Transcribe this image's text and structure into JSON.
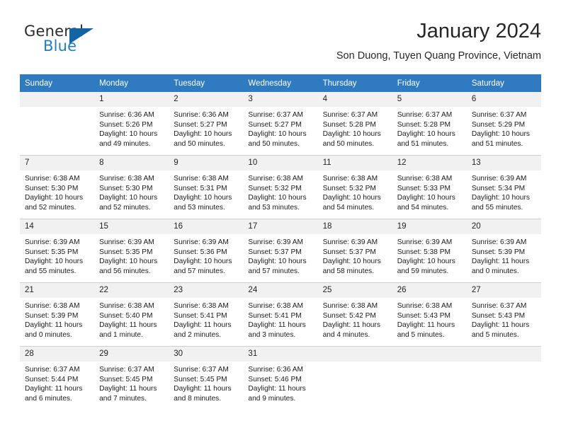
{
  "brand": {
    "name_part1": "General",
    "name_part2": "Blue",
    "triangle_color": "#1264a5",
    "blue_color": "#1f7ec4"
  },
  "header": {
    "title": "January 2024",
    "subtitle": "Son Duong, Tuyen Quang Province, Vietnam"
  },
  "theme": {
    "header_bg": "#2f7ac0",
    "daynum_bg": "#f1f1f1",
    "grid_line": "#cfcfcf"
  },
  "weekdays": [
    "Sunday",
    "Monday",
    "Tuesday",
    "Wednesday",
    "Thursday",
    "Friday",
    "Saturday"
  ],
  "weeks": [
    [
      {
        "day": "",
        "sunrise": "",
        "sunset": "",
        "daylight_line1": "",
        "daylight_line2": "",
        "blank": true
      },
      {
        "day": "1",
        "sunrise": "Sunrise: 6:36 AM",
        "sunset": "Sunset: 5:26 PM",
        "daylight_line1": "Daylight: 10 hours",
        "daylight_line2": "and 49 minutes."
      },
      {
        "day": "2",
        "sunrise": "Sunrise: 6:36 AM",
        "sunset": "Sunset: 5:27 PM",
        "daylight_line1": "Daylight: 10 hours",
        "daylight_line2": "and 50 minutes."
      },
      {
        "day": "3",
        "sunrise": "Sunrise: 6:37 AM",
        "sunset": "Sunset: 5:27 PM",
        "daylight_line1": "Daylight: 10 hours",
        "daylight_line2": "and 50 minutes."
      },
      {
        "day": "4",
        "sunrise": "Sunrise: 6:37 AM",
        "sunset": "Sunset: 5:28 PM",
        "daylight_line1": "Daylight: 10 hours",
        "daylight_line2": "and 50 minutes."
      },
      {
        "day": "5",
        "sunrise": "Sunrise: 6:37 AM",
        "sunset": "Sunset: 5:28 PM",
        "daylight_line1": "Daylight: 10 hours",
        "daylight_line2": "and 51 minutes."
      },
      {
        "day": "6",
        "sunrise": "Sunrise: 6:37 AM",
        "sunset": "Sunset: 5:29 PM",
        "daylight_line1": "Daylight: 10 hours",
        "daylight_line2": "and 51 minutes."
      }
    ],
    [
      {
        "day": "7",
        "sunrise": "Sunrise: 6:38 AM",
        "sunset": "Sunset: 5:30 PM",
        "daylight_line1": "Daylight: 10 hours",
        "daylight_line2": "and 52 minutes."
      },
      {
        "day": "8",
        "sunrise": "Sunrise: 6:38 AM",
        "sunset": "Sunset: 5:30 PM",
        "daylight_line1": "Daylight: 10 hours",
        "daylight_line2": "and 52 minutes."
      },
      {
        "day": "9",
        "sunrise": "Sunrise: 6:38 AM",
        "sunset": "Sunset: 5:31 PM",
        "daylight_line1": "Daylight: 10 hours",
        "daylight_line2": "and 53 minutes."
      },
      {
        "day": "10",
        "sunrise": "Sunrise: 6:38 AM",
        "sunset": "Sunset: 5:32 PM",
        "daylight_line1": "Daylight: 10 hours",
        "daylight_line2": "and 53 minutes."
      },
      {
        "day": "11",
        "sunrise": "Sunrise: 6:38 AM",
        "sunset": "Sunset: 5:32 PM",
        "daylight_line1": "Daylight: 10 hours",
        "daylight_line2": "and 54 minutes."
      },
      {
        "day": "12",
        "sunrise": "Sunrise: 6:38 AM",
        "sunset": "Sunset: 5:33 PM",
        "daylight_line1": "Daylight: 10 hours",
        "daylight_line2": "and 54 minutes."
      },
      {
        "day": "13",
        "sunrise": "Sunrise: 6:39 AM",
        "sunset": "Sunset: 5:34 PM",
        "daylight_line1": "Daylight: 10 hours",
        "daylight_line2": "and 55 minutes."
      }
    ],
    [
      {
        "day": "14",
        "sunrise": "Sunrise: 6:39 AM",
        "sunset": "Sunset: 5:35 PM",
        "daylight_line1": "Daylight: 10 hours",
        "daylight_line2": "and 55 minutes."
      },
      {
        "day": "15",
        "sunrise": "Sunrise: 6:39 AM",
        "sunset": "Sunset: 5:35 PM",
        "daylight_line1": "Daylight: 10 hours",
        "daylight_line2": "and 56 minutes."
      },
      {
        "day": "16",
        "sunrise": "Sunrise: 6:39 AM",
        "sunset": "Sunset: 5:36 PM",
        "daylight_line1": "Daylight: 10 hours",
        "daylight_line2": "and 57 minutes."
      },
      {
        "day": "17",
        "sunrise": "Sunrise: 6:39 AM",
        "sunset": "Sunset: 5:37 PM",
        "daylight_line1": "Daylight: 10 hours",
        "daylight_line2": "and 57 minutes."
      },
      {
        "day": "18",
        "sunrise": "Sunrise: 6:39 AM",
        "sunset": "Sunset: 5:37 PM",
        "daylight_line1": "Daylight: 10 hours",
        "daylight_line2": "and 58 minutes."
      },
      {
        "day": "19",
        "sunrise": "Sunrise: 6:39 AM",
        "sunset": "Sunset: 5:38 PM",
        "daylight_line1": "Daylight: 10 hours",
        "daylight_line2": "and 59 minutes."
      },
      {
        "day": "20",
        "sunrise": "Sunrise: 6:39 AM",
        "sunset": "Sunset: 5:39 PM",
        "daylight_line1": "Daylight: 11 hours",
        "daylight_line2": "and 0 minutes."
      }
    ],
    [
      {
        "day": "21",
        "sunrise": "Sunrise: 6:38 AM",
        "sunset": "Sunset: 5:39 PM",
        "daylight_line1": "Daylight: 11 hours",
        "daylight_line2": "and 0 minutes."
      },
      {
        "day": "22",
        "sunrise": "Sunrise: 6:38 AM",
        "sunset": "Sunset: 5:40 PM",
        "daylight_line1": "Daylight: 11 hours",
        "daylight_line2": "and 1 minute."
      },
      {
        "day": "23",
        "sunrise": "Sunrise: 6:38 AM",
        "sunset": "Sunset: 5:41 PM",
        "daylight_line1": "Daylight: 11 hours",
        "daylight_line2": "and 2 minutes."
      },
      {
        "day": "24",
        "sunrise": "Sunrise: 6:38 AM",
        "sunset": "Sunset: 5:41 PM",
        "daylight_line1": "Daylight: 11 hours",
        "daylight_line2": "and 3 minutes."
      },
      {
        "day": "25",
        "sunrise": "Sunrise: 6:38 AM",
        "sunset": "Sunset: 5:42 PM",
        "daylight_line1": "Daylight: 11 hours",
        "daylight_line2": "and 4 minutes."
      },
      {
        "day": "26",
        "sunrise": "Sunrise: 6:38 AM",
        "sunset": "Sunset: 5:43 PM",
        "daylight_line1": "Daylight: 11 hours",
        "daylight_line2": "and 5 minutes."
      },
      {
        "day": "27",
        "sunrise": "Sunrise: 6:37 AM",
        "sunset": "Sunset: 5:43 PM",
        "daylight_line1": "Daylight: 11 hours",
        "daylight_line2": "and 5 minutes."
      }
    ],
    [
      {
        "day": "28",
        "sunrise": "Sunrise: 6:37 AM",
        "sunset": "Sunset: 5:44 PM",
        "daylight_line1": "Daylight: 11 hours",
        "daylight_line2": "and 6 minutes."
      },
      {
        "day": "29",
        "sunrise": "Sunrise: 6:37 AM",
        "sunset": "Sunset: 5:45 PM",
        "daylight_line1": "Daylight: 11 hours",
        "daylight_line2": "and 7 minutes."
      },
      {
        "day": "30",
        "sunrise": "Sunrise: 6:37 AM",
        "sunset": "Sunset: 5:45 PM",
        "daylight_line1": "Daylight: 11 hours",
        "daylight_line2": "and 8 minutes."
      },
      {
        "day": "31",
        "sunrise": "Sunrise: 6:36 AM",
        "sunset": "Sunset: 5:46 PM",
        "daylight_line1": "Daylight: 11 hours",
        "daylight_line2": "and 9 minutes."
      },
      {
        "day": "",
        "sunrise": "",
        "sunset": "",
        "daylight_line1": "",
        "daylight_line2": "",
        "blank": true
      },
      {
        "day": "",
        "sunrise": "",
        "sunset": "",
        "daylight_line1": "",
        "daylight_line2": "",
        "blank": true
      },
      {
        "day": "",
        "sunrise": "",
        "sunset": "",
        "daylight_line1": "",
        "daylight_line2": "",
        "blank": true
      }
    ]
  ]
}
